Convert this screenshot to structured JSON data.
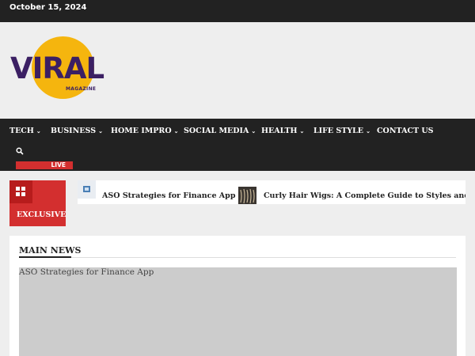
{
  "topbar": {
    "date": "October 15, 2024"
  },
  "logo": {
    "wordmark": "VIRAL",
    "tagline": "MAGAZINE",
    "sun_color": "#f5b50e",
    "text_color": "#3b1f63"
  },
  "nav": {
    "items": [
      {
        "label": "TECH",
        "has_dropdown": true
      },
      {
        "label": "BUSINESS",
        "has_dropdown": true
      },
      {
        "label": "HOME IMPRO",
        "has_dropdown": true
      },
      {
        "label": "SOCIAL MEDIA",
        "has_dropdown": true
      },
      {
        "label": "HEALTH",
        "has_dropdown": true
      },
      {
        "label": "LIFE STYLE",
        "has_dropdown": true
      },
      {
        "label": "CONTACT US",
        "has_dropdown": false
      }
    ],
    "chevron": "⌄",
    "search_icon": "search-icon",
    "live_label": "LIVE"
  },
  "exclusive": {
    "label": "EXCLUSIVE",
    "icon": "grid-icon",
    "color": "#d32f2f"
  },
  "ticker": {
    "items": [
      {
        "title": "ASO Strategies for Finance App",
        "thumb": "image-icon"
      },
      {
        "title": "Curly Hair Wigs: A Complete Guide to Styles and Car",
        "thumb": "photo-thumbnail"
      }
    ]
  },
  "main": {
    "heading": "MAIN NEWS",
    "featured_title": "ASO Strategies for Finance App"
  }
}
